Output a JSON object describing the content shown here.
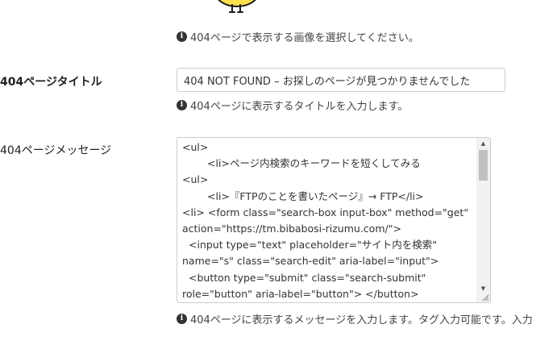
{
  "image_field": {
    "help_icon": "info-icon",
    "help_text": "404ページで表示する画像を選択してください。"
  },
  "title_field": {
    "label": "404ページタイトル",
    "value": "404 NOT FOUND – お探しのページが見つかりませんでした",
    "help_icon": "info-icon",
    "help_text": "404ページに表示するタイトルを入力します。"
  },
  "message_field": {
    "label": "404ページメッセージ",
    "lines": [
      "<ul>",
      "<li>ページ内検索のキーワードを短くしてみる",
      "<ul>",
      "<li>『FTPのことを書いたページ』→ FTP</li>",
      "<li> <form class=\"search-box input-box\" method=\"get\"",
      "action=\"https://tm.bibabosi-rizumu.com/\">",
      "<input type=\"text\" placeholder=\"サイト内を検索\"",
      "name=\"s\" class=\"search-edit\" aria-label=\"input\">",
      "<button type=\"submit\" class=\"search-submit\"",
      "role=\"button\" aria-label=\"button\"> </button>"
    ],
    "help_icon": "info-icon",
    "help_text": "404ページに表示するメッセージを入力します。タグ入力可能です。入力"
  },
  "colors": {
    "mascot_body": "#ffe14d",
    "mascot_outline": "#1a1a1a"
  }
}
